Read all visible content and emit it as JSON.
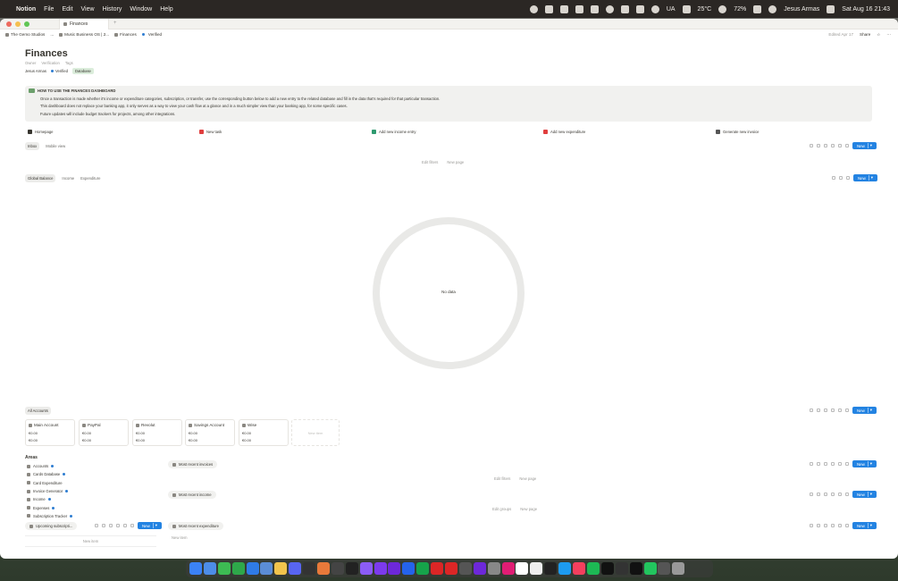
{
  "menubar": {
    "app": "Notion",
    "items": [
      "File",
      "Edit",
      "View",
      "History",
      "Window",
      "Help"
    ],
    "weather": "25°C",
    "battery": "72%",
    "input_source": "UA",
    "user": "Jesus Armas",
    "datetime": "Sat Aug 16  21:43"
  },
  "tab": {
    "title": "Finances"
  },
  "breadcrumb": {
    "items": [
      "The Gemo Studios",
      "...",
      "Music Business OS | 2...",
      "Finances",
      "Verified"
    ],
    "edited": "Edited Apr 17",
    "share": "Share"
  },
  "page": {
    "title": "Finances",
    "properties": {
      "labels": [
        "Owner",
        "Verification",
        "Tags"
      ],
      "owner": "Jesus Armas",
      "verification": "Verified",
      "tag": "Database"
    }
  },
  "callout": {
    "heading": "HOW TO USE THE FINANCES DASHBOARD",
    "lines": [
      "Once a transaction is made whether it's income or expenditure categories, subscription, or transfer, use the corresponding button below to add a new entry to the related database and fill in the data that's required for that particular transaction.",
      "This dashboard does not replace your banking app, it only serves as a way to view your cash flow at a glance and in a much simpler view than your banking app, for some specific cases.",
      "Future updates will include budget trackers for projects, among other integrations."
    ]
  },
  "buttons": [
    "Homepage",
    "New task",
    "Add new income entry",
    "Add new expenditure",
    "Generate new invoice"
  ],
  "view1": {
    "tabs": [
      "Inbox",
      "Mobile view"
    ],
    "edit_filters": "Edit filters",
    "new_page": "New page",
    "new": "New"
  },
  "view2": {
    "tabs": [
      "Global Balance",
      "Income",
      "Expenditure"
    ],
    "no_data": "No data",
    "new": "New"
  },
  "accounts": {
    "tab": "All Accounts",
    "new": "New",
    "new_item": "New item",
    "cards": [
      {
        "name": "Main Account",
        "v1": "€0.00",
        "v2": "€0.00"
      },
      {
        "name": "PayPal",
        "v1": "€0.00",
        "v2": "€0.00"
      },
      {
        "name": "Revolut",
        "v1": "€0.00",
        "v2": "€0.00"
      },
      {
        "name": "Savings Account",
        "v1": "€0.00",
        "v2": "€0.00"
      },
      {
        "name": "Wise",
        "v1": "€0.00",
        "v2": "€0.00"
      }
    ]
  },
  "areas": {
    "title": "Areas",
    "items": [
      "Accounts",
      "Cards Database",
      "Card Expenditure",
      "Invoice Generator",
      "Income",
      "Expenses",
      "Subscription Tracker"
    ]
  },
  "subs": {
    "tab": "Upcoming subscripti...",
    "new": "New",
    "new_item": "New item"
  },
  "recent": {
    "invoices": "Most recent invoices",
    "income": "Most recent income",
    "expenditure": "Most recent expenditure",
    "edit_filters": "Edit filters",
    "edit_groups": "Edit groups",
    "new_page": "New page",
    "new_item": "New item",
    "new": "New"
  }
}
